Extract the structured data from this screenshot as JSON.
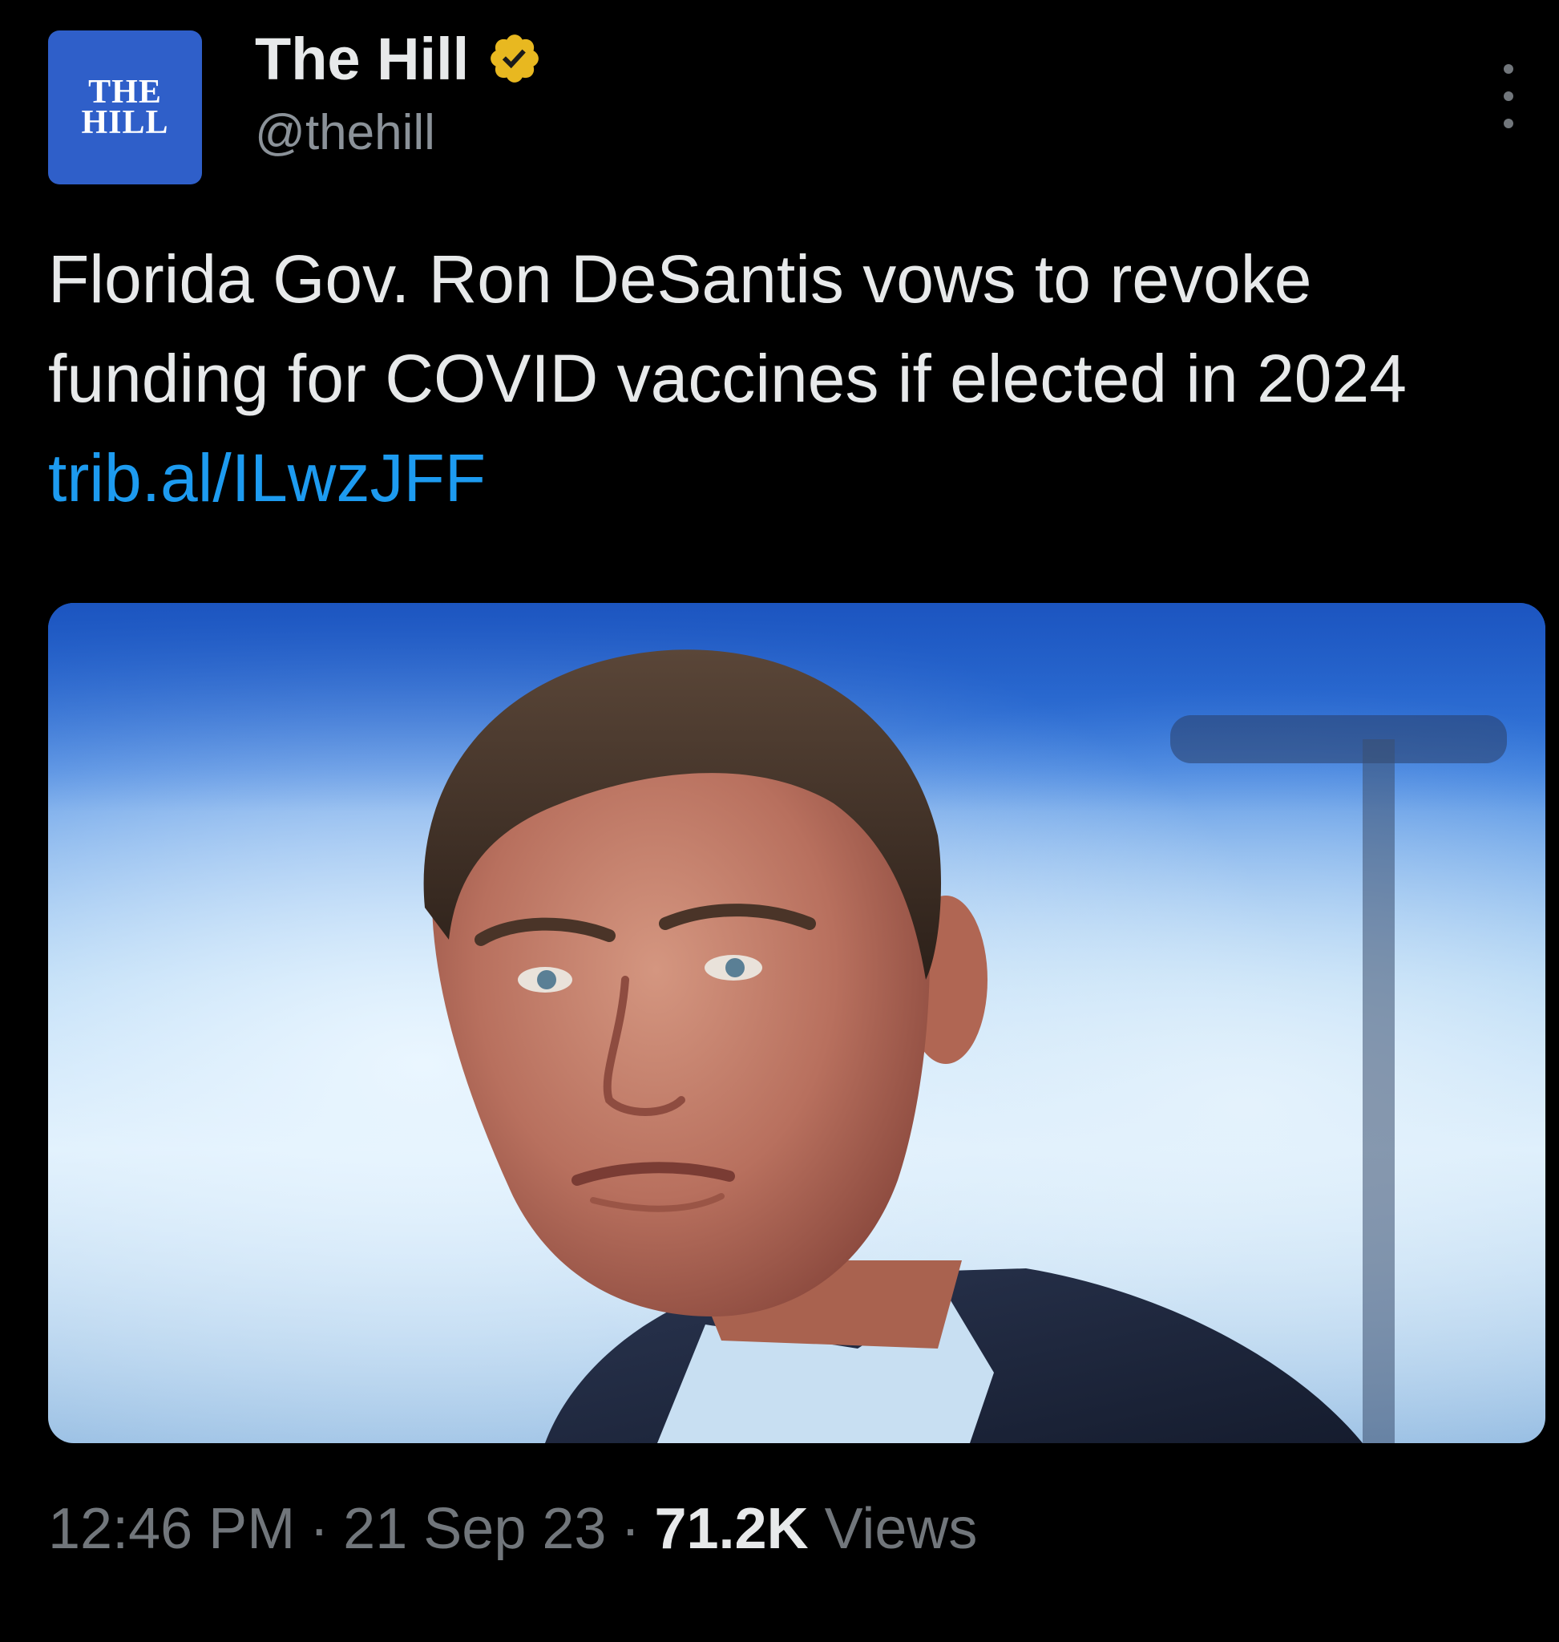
{
  "author": {
    "display_name": "The Hill",
    "handle": "@thehill",
    "avatar_text": "THE\nHILL",
    "avatar_color": "#2f5fc9",
    "verified_badge_color": "#e8b820",
    "verified_icon": "verified-check-icon"
  },
  "tweet": {
    "text": "Florida Gov. Ron DeSantis vows to revoke funding for COVID vaccines if elected in 2024 ",
    "link": "trib.al/ILwzJFF",
    "link_color": "#1d9bf0",
    "media": {
      "icon": "photo-image"
    }
  },
  "meta": {
    "time": "12:46 PM",
    "separator": "·",
    "date": "21 Sep 23",
    "views_count": "71.2K",
    "views_label": "Views"
  },
  "menu": {
    "icon": "more-options-icon"
  }
}
